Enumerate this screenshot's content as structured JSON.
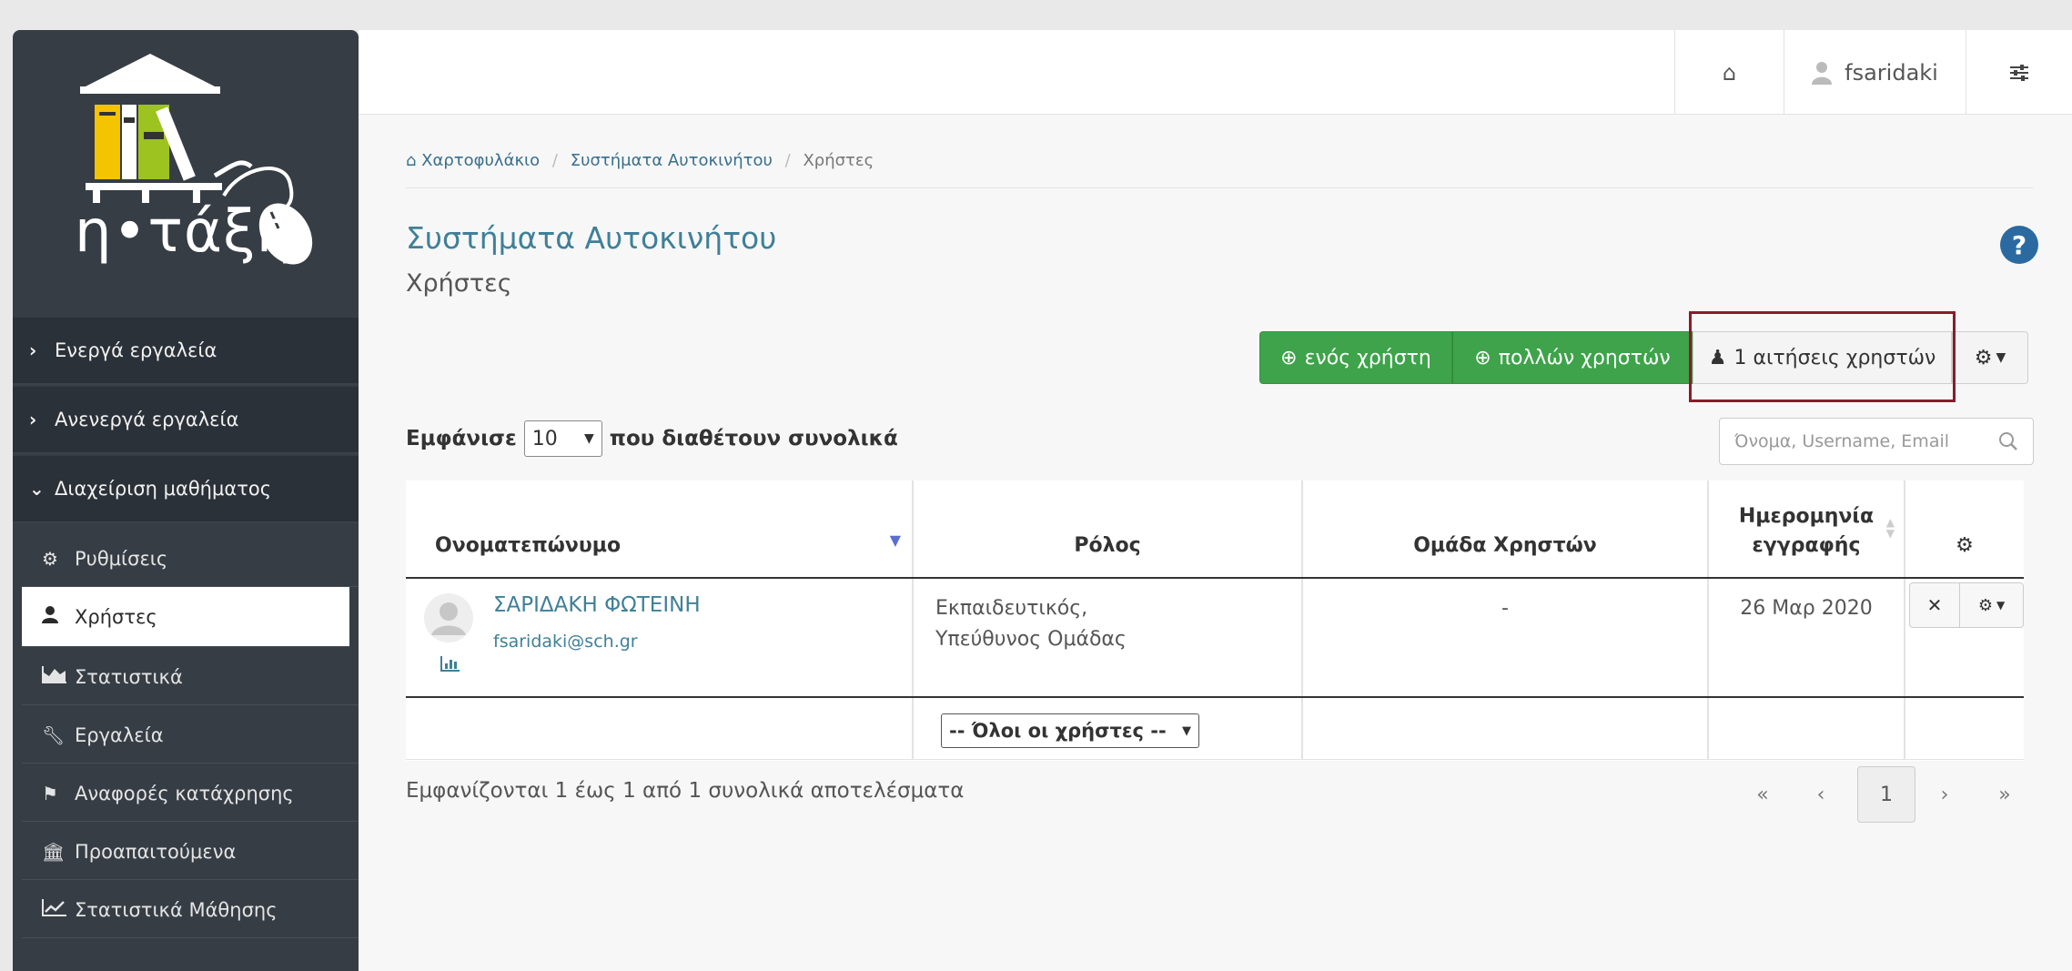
{
  "sidebar": {
    "logo_text": "η•τάξη",
    "sections": [
      {
        "label": "Ενεργά εργαλεία",
        "icon": "chevron-right-icon"
      },
      {
        "label": "Ανενεργά εργαλεία",
        "icon": "chevron-right-icon"
      },
      {
        "label": "Διαχείριση μαθήματος",
        "icon": "chevron-down-icon"
      }
    ],
    "items": [
      {
        "label": "Ρυθμίσεις",
        "icon": "gears-icon"
      },
      {
        "label": "Χρήστες",
        "icon": "user-icon",
        "active": true
      },
      {
        "label": "Στατιστικά",
        "icon": "area-chart-icon"
      },
      {
        "label": "Εργαλεία",
        "icon": "wrench-icon"
      },
      {
        "label": "Αναφορές κατάχρησης",
        "icon": "flag-icon"
      },
      {
        "label": "Προαπαιτούμενα",
        "icon": "institution-icon"
      },
      {
        "label": "Στατιστικά Μάθησης",
        "icon": "line-chart-icon"
      }
    ]
  },
  "topbar": {
    "username": "fsaridaki"
  },
  "breadcrumb": {
    "home": "Χαρτοφυλάκιο",
    "course": "Συστήματα Αυτοκινήτου",
    "current": "Χρήστες",
    "separator": "/"
  },
  "page": {
    "course_title": "Συστήματα Αυτοκινήτου",
    "subtitle": "Χρήστες",
    "help": "?"
  },
  "actions": {
    "add_one": "ενός χρήστη",
    "add_many": "πολλών χρηστών",
    "requests": "1 αιτήσεις χρηστών"
  },
  "list": {
    "show_prefix": "Εμφάνισε",
    "page_size": "10",
    "show_suffix": "που διαθέτουν συνολικά",
    "search_placeholder": "Όνομα, Username, Email"
  },
  "table": {
    "headers": {
      "name": "Ονοματεπώνυμο",
      "role": "Ρόλος",
      "group": "Ομάδα Χρηστών",
      "date_line1": "Ημερομηνία",
      "date_line2": "εγγραφής"
    },
    "rows": [
      {
        "name": "ΣΑΡΙΔΑΚΗ ΦΩΤΕΙΝΗ",
        "email": "fsaridaki@sch.gr",
        "role_line1": "Εκπαιδευτικός,",
        "role_line2": "Υπεύθυνος Ομάδας",
        "group": "-",
        "date": "26 Μαρ 2020"
      }
    ],
    "role_filter": "-- Όλοι οι χρήστες --"
  },
  "footer": {
    "summary": "Εμφανίζονται 1 έως 1 από 1 συνολικά αποτελέσματα",
    "first": "«",
    "prev": "‹",
    "page": "1",
    "next": "›",
    "last": "»"
  }
}
